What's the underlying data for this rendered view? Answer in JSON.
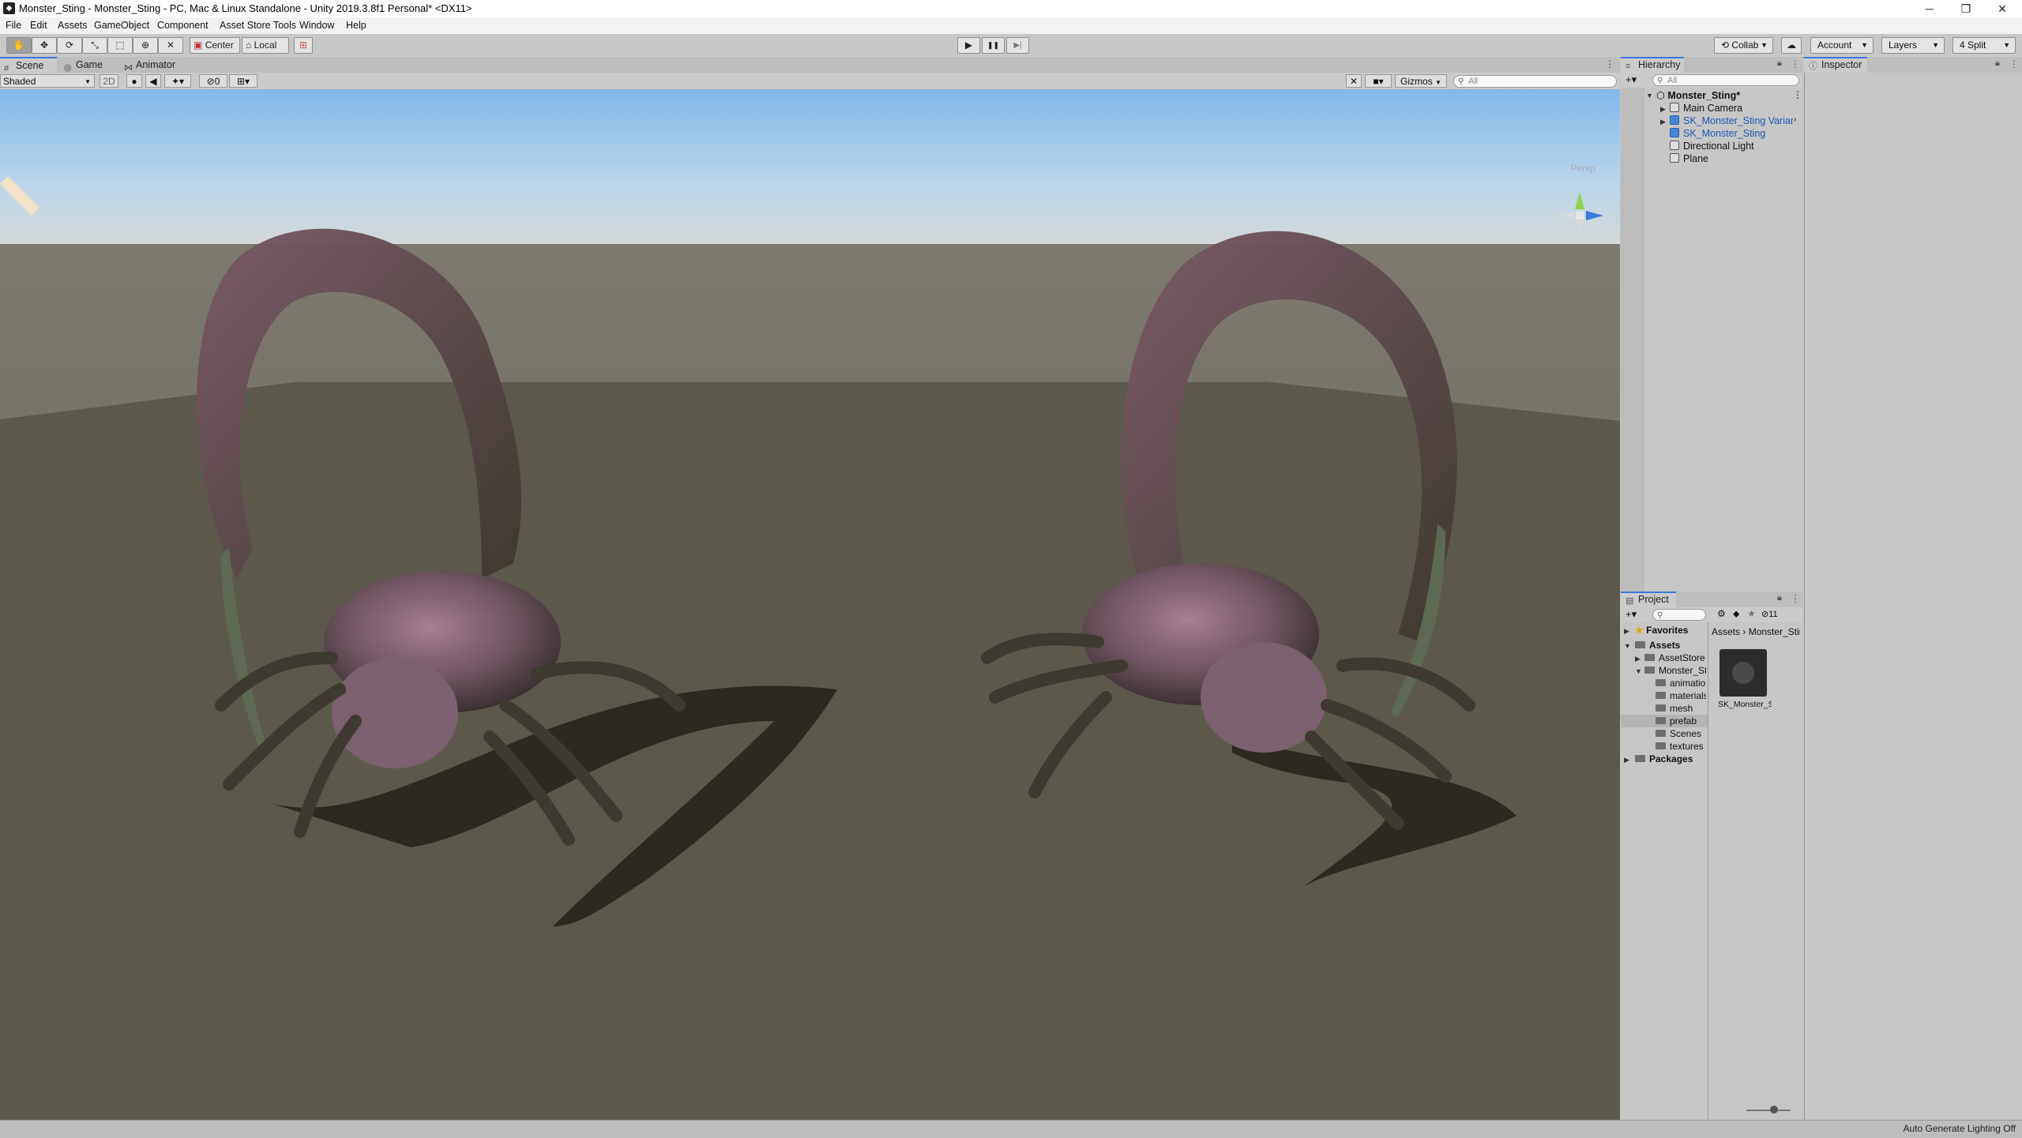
{
  "window": {
    "title": "Monster_Sting - Monster_Sting - PC, Mac & Linux Standalone - Unity 2019.3.8f1 Personal* <DX11>",
    "minimize": "─",
    "restore": "❐",
    "close": "✕"
  },
  "menu": [
    "File",
    "Edit",
    "Assets",
    "GameObject",
    "Component",
    "Asset Store Tools",
    "Window",
    "Help"
  ],
  "toolbar": {
    "pivot": "Center",
    "space": "Local",
    "collab": "Collab",
    "account": "Account",
    "layers": "Layers",
    "layout": "4 Split",
    "play": "▶",
    "pause": "❚❚",
    "step": "▶|"
  },
  "scene": {
    "tabs": [
      "Scene",
      "Game",
      "Animator"
    ],
    "shading": "Shaded",
    "mode_2d": "2D",
    "hidden_count": "0",
    "gizmos": "Gizmos",
    "search_placeholder": "All",
    "persp_label": "Persp"
  },
  "hierarchy": {
    "title": "Hierarchy",
    "search_placeholder": "All",
    "scene_name": "Monster_Sting*",
    "items": [
      {
        "label": "Main Camera",
        "prefab": false
      },
      {
        "label": "SK_Monster_Sting Variant",
        "prefab": true
      },
      {
        "label": "SK_Monster_Sting",
        "prefab": true
      },
      {
        "label": "Directional Light",
        "prefab": false
      },
      {
        "label": "Plane",
        "prefab": false
      }
    ]
  },
  "inspector": {
    "title": "Inspector"
  },
  "project": {
    "title": "Project",
    "hidden_count": "11",
    "favorites": "Favorites",
    "assets": "Assets",
    "folders": [
      "AssetStore",
      "Monster_Sting"
    ],
    "subfolders": [
      "animation",
      "materials",
      "mesh",
      "prefab",
      "Scenes",
      "textures"
    ],
    "packages": "Packages",
    "breadcrumb": [
      "Assets",
      "Monster_Sting"
    ],
    "breadcrumb_sep": "›",
    "asset_label": "SK_Monster_Sting"
  },
  "status": {
    "lighting": "Auto Generate Lighting Off"
  },
  "colors": {
    "accent": "#3a79d9",
    "sky_top": "#8fc3f0",
    "ground": "#5a574b",
    "editor_bg": "#c2c2c2"
  }
}
